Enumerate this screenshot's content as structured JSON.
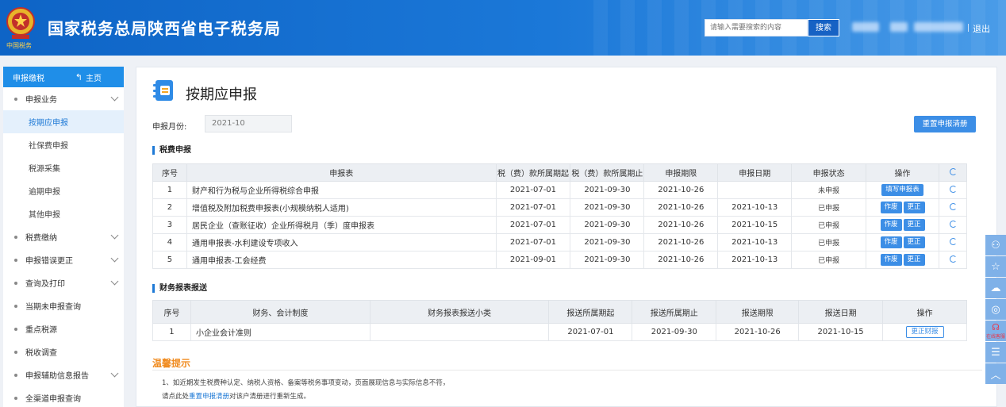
{
  "header": {
    "title": "国家税务总局陕西省电子税务局",
    "search_placeholder": "请输入需要搜索的内容",
    "search_button": "搜索",
    "logout": "退出",
    "emblem_text": "中国税务"
  },
  "sidebar": {
    "head_title": "申报缴税",
    "home_label": "主页",
    "items": [
      {
        "label": "申报业务",
        "expandable": true
      },
      {
        "label": "按期应申报",
        "sub": true,
        "active": true
      },
      {
        "label": "社保费申报",
        "sub": true
      },
      {
        "label": "税源采集",
        "sub": true
      },
      {
        "label": "逾期申报",
        "sub": true
      },
      {
        "label": "其他申报",
        "sub": true
      },
      {
        "label": "税费缴纳",
        "expandable": true
      },
      {
        "label": "申报错误更正",
        "expandable": true
      },
      {
        "label": "查询及打印",
        "expandable": true
      },
      {
        "label": "当期未申报查询"
      },
      {
        "label": "重点税源"
      },
      {
        "label": "税收调查"
      },
      {
        "label": "申报辅助信息报告",
        "expandable": true
      },
      {
        "label": "全渠道申报查询"
      }
    ]
  },
  "main": {
    "title": "按期应申报",
    "month_label": "申报月份:",
    "month_value": "2021-10",
    "reset_button": "重置申报清册",
    "tax_section": {
      "label": "税费申报",
      "headers": [
        "序号",
        "申报表",
        "税（费）款所属期起",
        "税（费）款所属期止",
        "申报期限",
        "申报日期",
        "申报状态",
        "操作"
      ],
      "rows": [
        {
          "no": "1",
          "form": "财产和行为税与企业所得税综合申报",
          "start": "2021-07-01",
          "end": "2021-09-30",
          "deadline": "2021-10-26",
          "date": "",
          "status": "未申报",
          "ops": [
            "填写申报表"
          ]
        },
        {
          "no": "2",
          "form": "增值税及附加税费申报表(小规模纳税人适用)",
          "start": "2021-07-01",
          "end": "2021-09-30",
          "deadline": "2021-10-26",
          "date": "2021-10-13",
          "status": "已申报",
          "ops": [
            "作废",
            "更正"
          ]
        },
        {
          "no": "3",
          "form": "居民企业（查账征收）企业所得税月（季）度申报表",
          "start": "2021-07-01",
          "end": "2021-09-30",
          "deadline": "2021-10-26",
          "date": "2021-10-15",
          "status": "已申报",
          "ops": [
            "作废",
            "更正"
          ]
        },
        {
          "no": "4",
          "form": "通用申报表-水利建设专项收入",
          "start": "2021-07-01",
          "end": "2021-09-30",
          "deadline": "2021-10-26",
          "date": "2021-10-13",
          "status": "已申报",
          "ops": [
            "作废",
            "更正"
          ]
        },
        {
          "no": "5",
          "form": "通用申报表-工会经费",
          "start": "2021-09-01",
          "end": "2021-09-30",
          "deadline": "2021-10-26",
          "date": "2021-10-13",
          "status": "已申报",
          "ops": [
            "作废",
            "更正"
          ]
        }
      ]
    },
    "finance_section": {
      "label": "财务报表报送",
      "headers": [
        "序号",
        "财务、会计制度",
        "财务报表报送小类",
        "报送所属期起",
        "报送所属期止",
        "报送期限",
        "报送日期",
        "操作"
      ],
      "rows": [
        {
          "no": "1",
          "system": "小企业会计准则",
          "subtype": "",
          "start": "2021-07-01",
          "end": "2021-09-30",
          "deadline": "2021-10-26",
          "date": "2021-10-15",
          "op": "更正财报"
        }
      ]
    },
    "tips": {
      "title": "温馨提示",
      "line1": "1、如近期发生税费种认定、纳税人资格、备案等税务事项变动，页面展现信息与实际信息不符，",
      "line2_pre": "请点此处",
      "line2_link": "重置申报清册",
      "line2_post": "对该户清册进行重新生成。"
    }
  },
  "float_bar": {
    "service_label": "在线客服"
  }
}
